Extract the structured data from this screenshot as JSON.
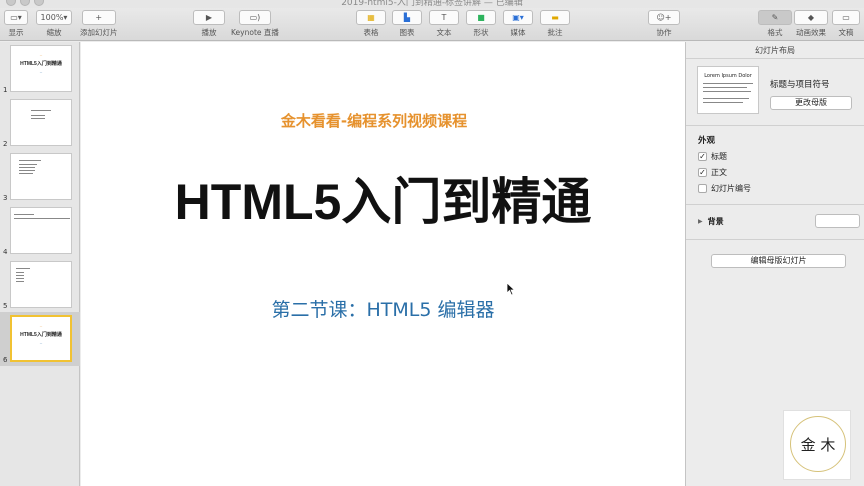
{
  "window": {
    "title": "2019-html5-入门到精通-标签讲解 — 已编辑"
  },
  "toolbar": {
    "view_label": "显示",
    "zoom_value": "100%",
    "zoom_label": "缩放",
    "add_slide_label": "添加幻灯片",
    "play_label": "播放",
    "keynote_live_label": "Keynote 直播",
    "table_label": "表格",
    "chart_label": "图表",
    "text_label": "文本",
    "shape_label": "形状",
    "media_label": "媒体",
    "comment_label": "批注",
    "collaborate_label": "协作",
    "format_label": "格式",
    "animate_label": "动画效果",
    "document_label": "文稿"
  },
  "navigator": {
    "slides": [
      {
        "number": "1",
        "title": "HTML5入门到精通"
      },
      {
        "number": "2"
      },
      {
        "number": "3"
      },
      {
        "number": "4"
      },
      {
        "number": "5"
      },
      {
        "number": "6",
        "title": "HTML5入门到精通"
      }
    ]
  },
  "slide": {
    "subtitle_top": "金木看看-编程系列视频课程",
    "title": "HTML5入门到精通",
    "subtitle_bottom": "第二节课：HTML5 编辑器"
  },
  "inspector": {
    "header": "幻灯片布局",
    "layout_thumb_title": "Lorem Ipsum Dolor",
    "layout_name": "标题与项目符号",
    "change_master": "更改母版",
    "appearance": "外观",
    "options": [
      {
        "label": "标题",
        "checked": true
      },
      {
        "label": "正文",
        "checked": true
      },
      {
        "label": "幻灯片编号",
        "checked": false
      }
    ],
    "background_label": "背景",
    "edit_master": "编辑母版幻灯片"
  },
  "logo": {
    "text": "金 木"
  },
  "colors": {
    "accent_orange": "#e6922e",
    "accent_blue": "#2a6fa8",
    "selection": "#f1c232"
  }
}
